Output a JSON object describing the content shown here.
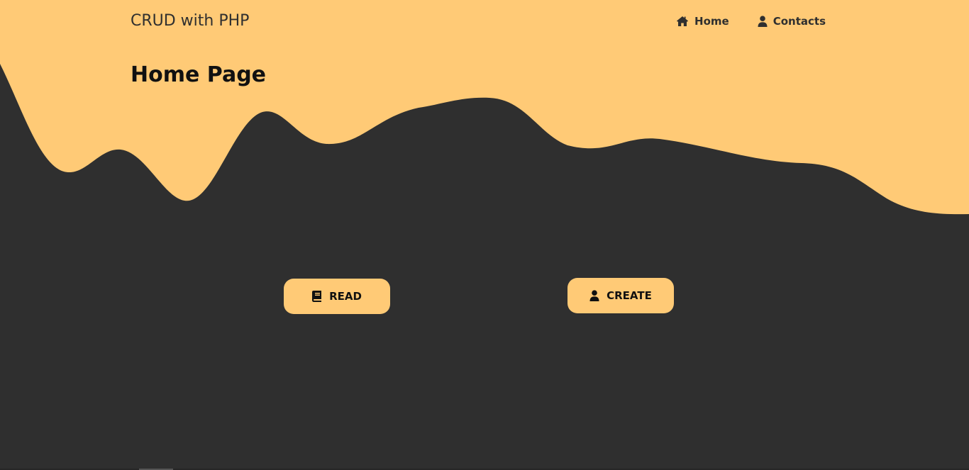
{
  "navbar": {
    "brand": "CRUD with PHP",
    "links": [
      {
        "label": "Home",
        "icon": "home-icon"
      },
      {
        "label": "Contacts",
        "icon": "user-icon"
      }
    ]
  },
  "main": {
    "title": "Home Page",
    "buttons": {
      "read_label": "READ",
      "read_icon": "book-icon",
      "create_label": "CREATE",
      "create_icon": "user-icon"
    }
  },
  "colors": {
    "accent": "#ffca76",
    "background": "#2f2f2f",
    "text_dark": "#111111"
  }
}
